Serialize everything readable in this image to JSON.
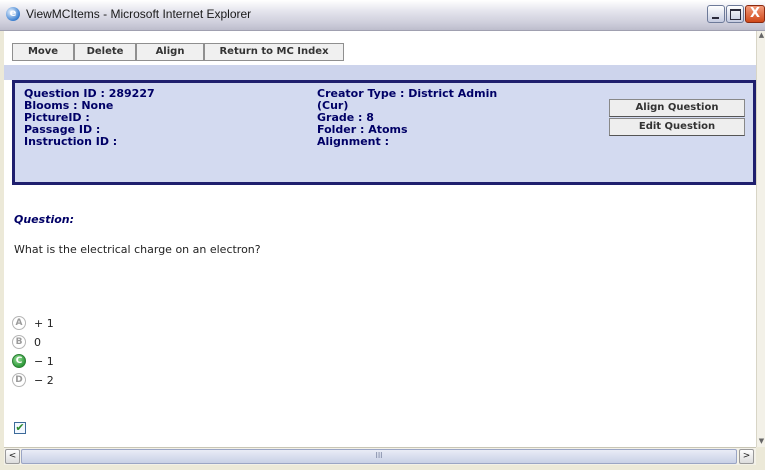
{
  "window": {
    "title": "ViewMCItems - Microsoft Internet Explorer",
    "close_glyph": "X"
  },
  "toolbar": {
    "move_label": "Move",
    "delete_label": "Delete",
    "align_label": "Align",
    "return_label": "Return to MC Index"
  },
  "info": {
    "question_id": "Question ID : 289227",
    "blooms": "Blooms : None",
    "picture_id": "PictureID :",
    "passage_id": "Passage ID :",
    "instruction_id": "Instruction ID :",
    "creator_type": "Creator Type : District Admin",
    "creator_cur": "(Cur)",
    "grade": "Grade : 8",
    "folder": "Folder : Atoms",
    "alignment": "Alignment :",
    "align_question_label": "Align Question",
    "edit_question_label": "Edit Question"
  },
  "question": {
    "label": "Question:",
    "text": "What is the electrical charge on an electron?"
  },
  "options": [
    {
      "letter": "A",
      "text": "+ 1",
      "correct": false
    },
    {
      "letter": "B",
      "text": "0",
      "correct": false
    },
    {
      "letter": "C",
      "text": "− 1",
      "correct": true
    },
    {
      "letter": "D",
      "text": "− 2",
      "correct": false
    }
  ],
  "checkbox": {
    "checked": true,
    "glyph": "✔"
  },
  "scrollbar": {
    "left_arrow": "<",
    "right_arrow": ">",
    "thumb_grip": "III",
    "up_arrow": "▲",
    "down_arrow": "▼"
  }
}
